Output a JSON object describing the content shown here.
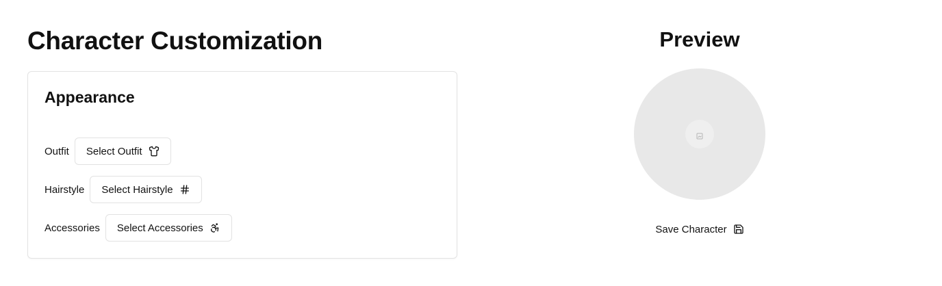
{
  "page": {
    "title": "Character Customization"
  },
  "appearance": {
    "title": "Appearance",
    "fields": [
      {
        "label": "Outfit",
        "button_label": "Select Outfit",
        "icon": "shirt-icon"
      },
      {
        "label": "Hairstyle",
        "button_label": "Select Hairstyle",
        "icon": "hash-icon"
      },
      {
        "label": "Accessories",
        "button_label": "Select Accessories",
        "icon": "accessibility-icon"
      }
    ]
  },
  "preview": {
    "title": "Preview",
    "avatar_icon": "image-placeholder-icon",
    "save_label": "Save Character",
    "save_icon": "save-icon"
  },
  "colors": {
    "text": "#111111",
    "border": "#e2e2e2",
    "avatar_bg": "#e8e8e8",
    "background": "#ffffff"
  }
}
